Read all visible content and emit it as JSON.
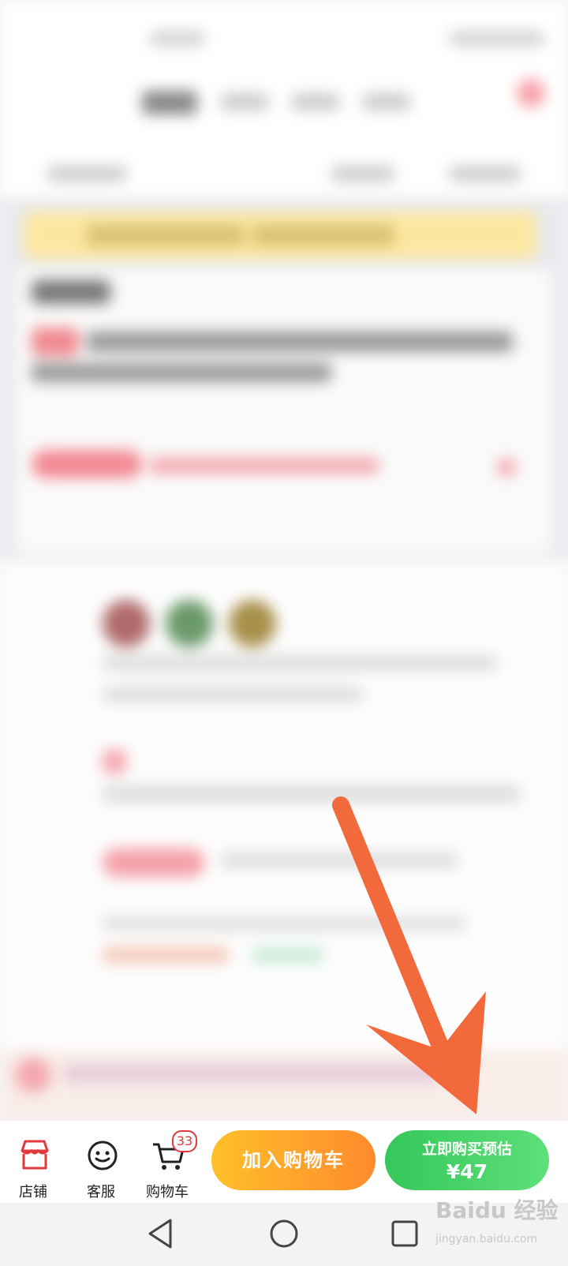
{
  "bottom_bar": {
    "store_label": "店铺",
    "service_label": "客服",
    "cart_label": "购物车",
    "cart_count": "33",
    "add_to_cart_label": "加入购物车",
    "buy_now_line1": "立即购买预估",
    "buy_now_price": "¥47"
  },
  "watermark": {
    "brand": "Baidu 经验",
    "url": "jingyan.baidu.com"
  },
  "colors": {
    "store_red": "#e0393e",
    "cart_button": "#ffa12b",
    "buy_button": "#4cd46b",
    "arrow": "#f26a3c"
  },
  "icons": [
    "store-icon",
    "service-icon",
    "cart-icon",
    "back-icon",
    "home-icon",
    "recents-icon"
  ]
}
